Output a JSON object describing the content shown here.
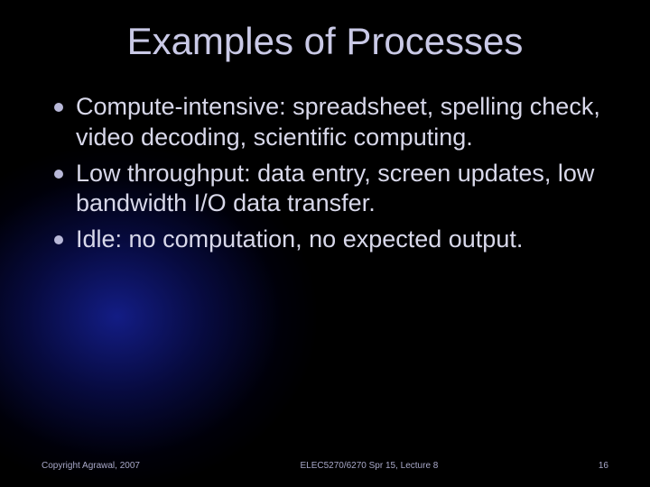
{
  "title": "Examples of Processes",
  "bullets": [
    "Compute-intensive: spreadsheet, spelling check, video decoding, scientific computing.",
    "Low throughput: data entry, screen updates, low bandwidth I/O data transfer.",
    "Idle: no computation, no expected output."
  ],
  "footer": {
    "left": "Copyright Agrawal, 2007",
    "center": "ELEC5270/6270 Spr 15, Lecture 8",
    "right": "16"
  }
}
